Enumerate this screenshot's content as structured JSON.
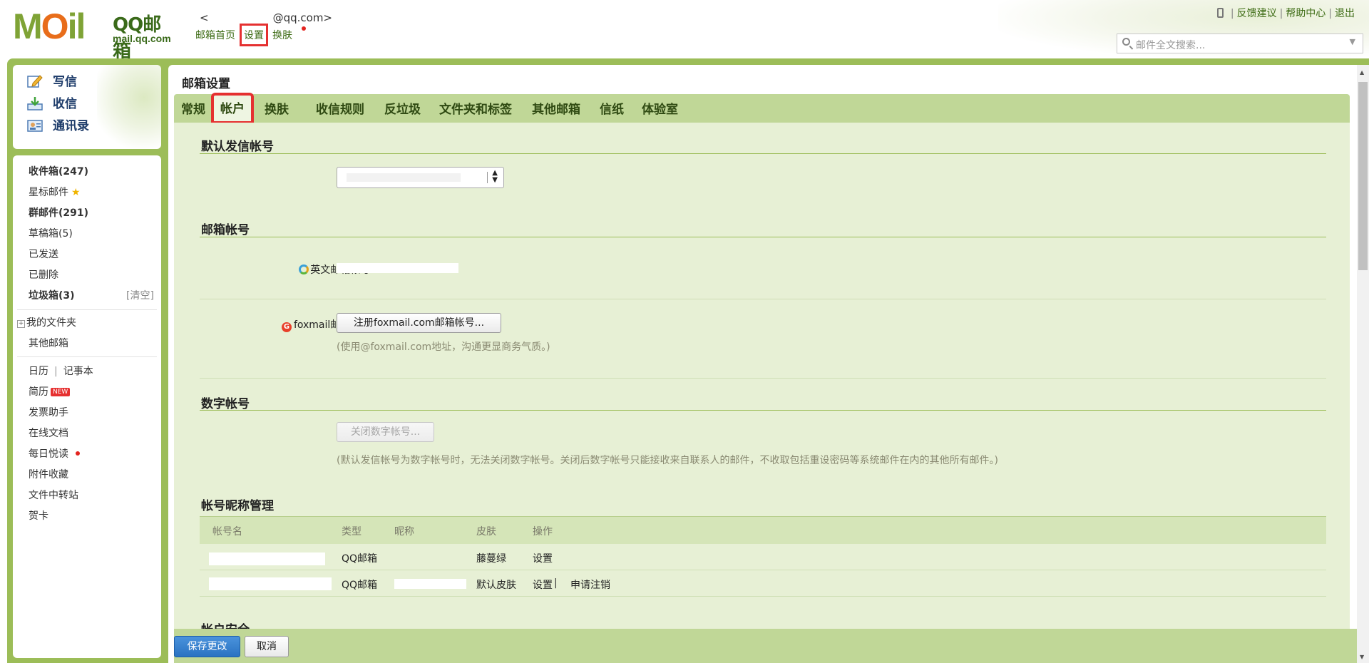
{
  "header": {
    "logo_text": "MOil",
    "logo_brand": "QQ邮箱",
    "logo_domain": "mail.qq.com",
    "user_email_prefix": "<",
    "user_email_suffix": "@qq.com>",
    "nav": {
      "home": "邮箱首页",
      "settings": "设置",
      "skin": "换肤"
    },
    "links": {
      "feedback": "反馈建议",
      "help": "帮助中心",
      "logout": "退出",
      "separator": "|"
    },
    "search": {
      "placeholder": "邮件全文搜索..."
    }
  },
  "quick_actions": {
    "compose": "写信",
    "receive": "收信",
    "contacts": "通讯录"
  },
  "folders": {
    "inbox": "收件箱(247)",
    "starred": "星标邮件",
    "groups": "群邮件(291)",
    "drafts": "草稿箱(5)",
    "sent": "已发送",
    "deleted": "已删除",
    "trash": "垃圾箱(3)",
    "trash_clear": "[清空]",
    "my_folders": "我的文件夹",
    "other_mailboxes": "其他邮箱",
    "calendar": "日历",
    "notebook": "记事本",
    "separator": "|",
    "resume": "简历",
    "new_badge": "NEW",
    "invoice": "发票助手",
    "online_docs": "在线文档",
    "daily_read": "每日悦读",
    "attachments": "附件收藏",
    "file_transfer": "文件中转站",
    "cards": "贺卡"
  },
  "main": {
    "title": "邮箱设置",
    "tabs": [
      "常规",
      "帐户",
      "换肤",
      "收信规则",
      "反垃圾",
      "文件夹和标签",
      "其他邮箱",
      "信纸",
      "体验室"
    ],
    "active_tab": "帐户",
    "sections": {
      "default_sender": "默认发信帐号",
      "mail_accounts": "邮箱帐号",
      "english_account_label": "英文邮箱帐号:",
      "foxmail_label": "foxmail邮箱帐号:",
      "foxmail_button": "注册foxmail.com邮箱帐号...",
      "foxmail_hint": "(使用@foxmail.com地址，沟通更显商务气质。)",
      "digital_account": "数字帐号",
      "digital_button": "关闭数字帐号...",
      "digital_hint": "(默认发信帐号为数字帐号时，无法关闭数字帐号。关闭后数字帐号只能接收来自联系人的邮件，不收取包括重设密码等系统邮件在内的其他所有邮件。)",
      "nickname_mgmt": "帐号昵称管理",
      "account_security": "帐户安全"
    },
    "table": {
      "headers": [
        "帐号名",
        "类型",
        "昵称",
        "皮肤",
        "操作"
      ],
      "rows": [
        {
          "type": "QQ邮箱",
          "skin": "藤蔓绿",
          "action1": "设置",
          "action2": ""
        },
        {
          "type": "QQ邮箱",
          "skin": "默认皮肤",
          "action1": "设置",
          "action2": "申请注销"
        }
      ],
      "action_sep": "|"
    },
    "footer": {
      "save": "保存更改",
      "cancel": "取消"
    }
  },
  "colors": {
    "frame_green": "#9cbd58",
    "tab_green": "#c0d797",
    "content_green": "#e7f0d5",
    "highlight_red": "#e53030",
    "primary_blue": "#2a78c9"
  }
}
